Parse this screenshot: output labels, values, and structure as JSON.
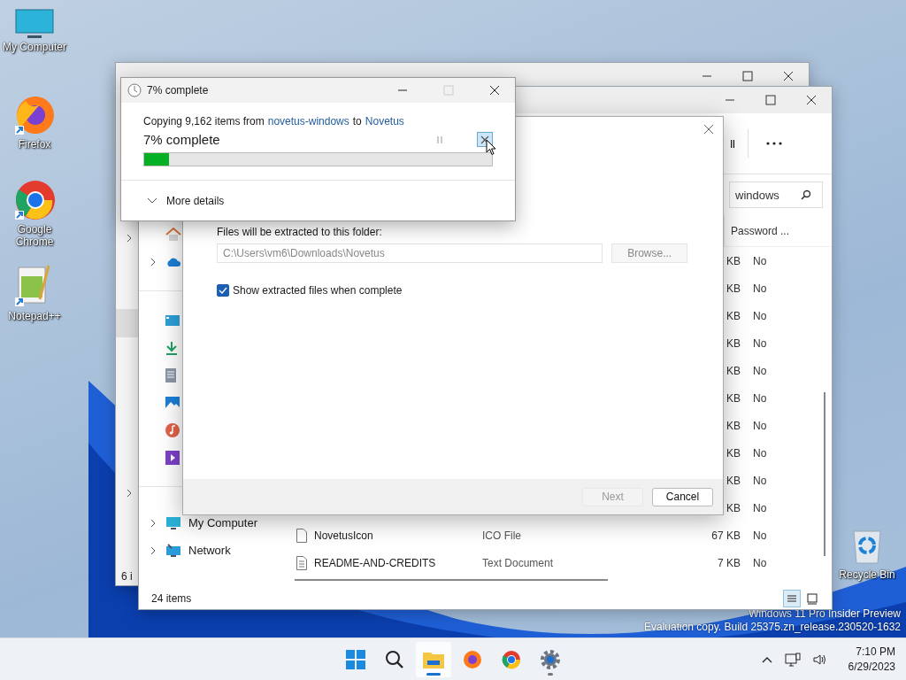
{
  "desktop": {
    "icons": [
      {
        "label": "My Computer",
        "kind": "computer"
      },
      {
        "label": "Firefox",
        "kind": "firefox"
      },
      {
        "label": "Google Chrome",
        "kind": "chrome"
      },
      {
        "label": "Notepad++",
        "kind": "notepad"
      }
    ],
    "recycle_bin": {
      "label": "Recycle Bin"
    },
    "watermark": [
      "Windows 11 Pro Insider Preview",
      "Evaluation copy. Build 25375.zn_release.230520-1632"
    ]
  },
  "back_window": {
    "status_bar": "6 i"
  },
  "explorer": {
    "toolbar_button": "ll",
    "search": {
      "value": "windows"
    },
    "columns": [
      "Password ..."
    ],
    "sidebar": [
      [
        {
          "kind": "home",
          "expandable": false
        },
        {
          "kind": "cloud",
          "expandable": true
        }
      ],
      [
        {
          "kind": "desktop",
          "expandable": false
        },
        {
          "kind": "downloads",
          "expandable": false
        },
        {
          "kind": "documents",
          "expandable": false
        },
        {
          "kind": "pictures",
          "expandable": false
        },
        {
          "kind": "music",
          "expandable": false
        },
        {
          "kind": "videos",
          "expandable": false
        }
      ],
      [
        {
          "kind": "computer",
          "label": "My Computer",
          "expandable": true
        },
        {
          "kind": "network",
          "label": "Network",
          "expandable": true
        }
      ]
    ],
    "rows": [
      {
        "size": "KB",
        "password": "No"
      },
      {
        "size": "KB",
        "password": "No"
      },
      {
        "size": "KB",
        "password": "No"
      },
      {
        "size": "KB",
        "password": "No"
      },
      {
        "size": "KB",
        "password": "No"
      },
      {
        "size": "KB",
        "password": "No"
      },
      {
        "size": "KB",
        "password": "No"
      },
      {
        "size": "KB",
        "password": "No"
      },
      {
        "size": "KB",
        "password": "No"
      },
      {
        "size": "KB",
        "password": "No"
      },
      {
        "kind": "file",
        "name": "NovetusIcon",
        "type": "ICO File",
        "size": "67 KB",
        "password": "No"
      },
      {
        "kind": "text",
        "name": "README-AND-CREDITS",
        "type": "Text Document",
        "size": "7 KB",
        "password": "No"
      }
    ],
    "status_bar": "24 items",
    "views": [
      {
        "kind": "details",
        "selected": true
      },
      {
        "kind": "tiles",
        "selected": false
      }
    ]
  },
  "extract_dialog": {
    "folder_label": "Files will be extracted to this folder:",
    "path": "C:\\Users\\vm6\\Downloads\\Novetus",
    "browse": "Browse...",
    "show_files": {
      "label": "Show extracted files when complete",
      "checked": true
    },
    "buttons": [
      {
        "label": "Next",
        "disabled": true
      },
      {
        "label": "Cancel",
        "disabled": false
      }
    ]
  },
  "copy_dialog": {
    "title": "7% complete",
    "prefix": "Copying 9,162 items from",
    "source": "novetus-windows",
    "middle": "to",
    "destination": "Novetus",
    "subtitle": "7% complete",
    "level": 0.07,
    "details": "More details"
  },
  "taskbar": {
    "apps": [
      {
        "kind": "start",
        "selected": false,
        "running": false
      },
      {
        "kind": "search",
        "selected": false,
        "running": false
      },
      {
        "kind": "explorer",
        "selected": true,
        "running": true
      },
      {
        "kind": "firefox",
        "selected": false,
        "running": false
      },
      {
        "kind": "chrome",
        "selected": false,
        "running": false
      },
      {
        "kind": "settings",
        "selected": false,
        "running": true
      }
    ],
    "time": "7:10 PM",
    "date": "6/29/2023"
  }
}
